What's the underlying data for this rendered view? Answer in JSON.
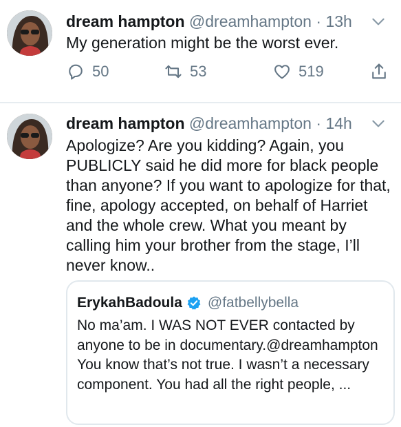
{
  "tweets": [
    {
      "name": "dream hampton",
      "handle": "@dreamhampton",
      "separator": "·",
      "time": "13h",
      "text": "My generation might be the worst ever.",
      "replies": "50",
      "retweets": "53",
      "likes": "519"
    },
    {
      "name": "dream hampton",
      "handle": "@dreamhampton",
      "separator": "·",
      "time": "14h",
      "text": "Apologize? Are you kidding? Again, you PUBLICLY said he did more for black people than anyone? If you want to apologize for that, fine, apology accepted, on behalf of Harriet and the whole crew. What you meant by calling him your brother from the stage, I’ll never know..",
      "quote": {
        "name": "ErykahBadoula",
        "handle": "@fatbellybella",
        "text": "No ma’am. I WAS NOT EVER contacted by anyone to be in documentary.@dreamhampton You know that’s not true. I wasn’t a necessary component. You had all the right people, ..."
      }
    }
  ],
  "icons": {
    "reply": "reply-icon",
    "retweet": "retweet-icon",
    "like": "heart-icon",
    "share": "share-icon",
    "menu": "chevron-down-icon",
    "verified": "verified-badge-icon"
  },
  "colors": {
    "text": "#14171a",
    "secondary": "#657786",
    "verified": "#1da1f2",
    "border": "#e1e8ed"
  }
}
